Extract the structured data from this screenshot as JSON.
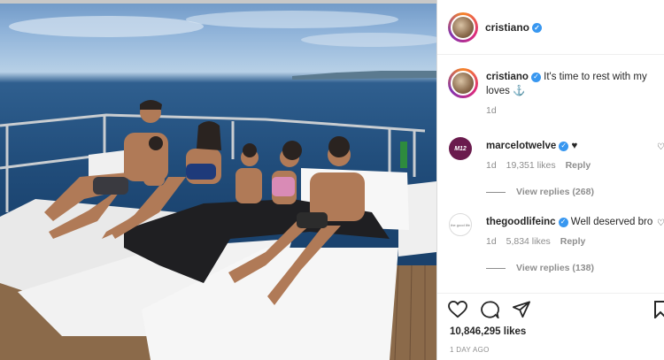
{
  "post": {
    "username": "cristiano",
    "verified_mark": "✓",
    "caption": "It's time to rest with my loves",
    "caption_emoji": "⚓",
    "caption_time": "1d"
  },
  "comments": [
    {
      "username": "marcelotwelve",
      "text": "♥",
      "time": "1d",
      "likes": "19,351 likes",
      "reply_label": "Reply",
      "view_replies": "View replies (268)",
      "avatar_text": "M12"
    },
    {
      "username": "thegoodlifeinc",
      "text": "Well deserved bro",
      "time": "1d",
      "likes": "5,834 likes",
      "reply_label": "Reply",
      "view_replies": "View replies (138)",
      "avatar_text": "the good life"
    }
  ],
  "footer": {
    "likes_count": "10,846,295 likes",
    "posted": "1 DAY AGO"
  },
  "icons": {
    "like": "heart-icon",
    "comment": "comment-icon",
    "share": "share-icon",
    "save": "bookmark-icon",
    "comment_like": "heart-outline-icon"
  },
  "colors": {
    "verified": "#3897f0",
    "text": "#262626",
    "muted": "#8e8e8e",
    "border": "#dbdbdb"
  }
}
